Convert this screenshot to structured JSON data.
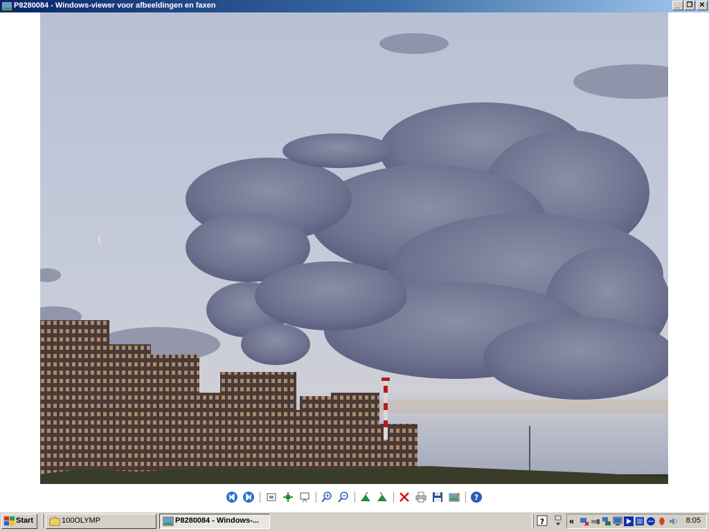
{
  "window": {
    "title": "P8280084 - Windows-viewer voor afbeeldingen en faxen",
    "minimize_label": "_",
    "restore_label": "❐",
    "close_label": "✕"
  },
  "image": {
    "description_icon": "photo-coastline-clouds"
  },
  "toolbar": {
    "buttons": [
      {
        "name": "previous-image-button",
        "icon": "previous-icon"
      },
      {
        "name": "next-image-button",
        "icon": "next-icon"
      },
      {
        "name": "best-fit-button",
        "icon": "best-fit-icon"
      },
      {
        "name": "actual-size-button",
        "icon": "actual-size-icon"
      },
      {
        "name": "slideshow-button",
        "icon": "slideshow-icon"
      },
      {
        "name": "zoom-in-button",
        "icon": "zoom-in-icon"
      },
      {
        "name": "zoom-out-button",
        "icon": "zoom-out-icon"
      },
      {
        "name": "rotate-clockwise-button",
        "icon": "rotate-clockwise-icon"
      },
      {
        "name": "rotate-counterclockwise-button",
        "icon": "rotate-counterclockwise-icon"
      },
      {
        "name": "delete-button",
        "icon": "delete-icon"
      },
      {
        "name": "print-button",
        "icon": "print-icon"
      },
      {
        "name": "save-button",
        "icon": "save-icon"
      },
      {
        "name": "edit-button",
        "icon": "edit-icon"
      },
      {
        "name": "help-button",
        "icon": "help-icon"
      }
    ]
  },
  "taskbar": {
    "start_label": "Start",
    "tasks": [
      {
        "label": "100OLYMP",
        "icon": "folder-icon"
      },
      {
        "label": "P8280084 - Windows-...",
        "icon": "image-viewer-icon"
      }
    ],
    "tray_collapse": "«",
    "clock": "8:05"
  },
  "colors": {
    "title_start": "#0a246a",
    "title_end": "#a6caf0",
    "chrome": "#d4d0c8"
  }
}
